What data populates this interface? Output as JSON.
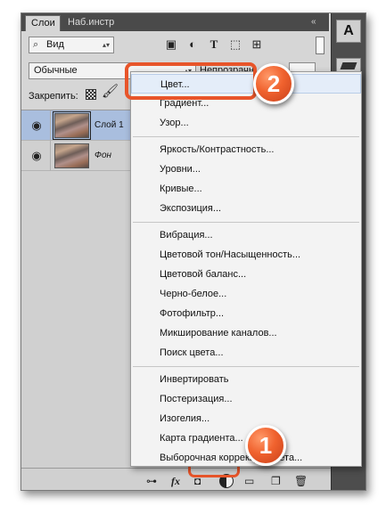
{
  "tabs": {
    "active": "Слои",
    "inactive": "Наб.инстр",
    "collapse": "«"
  },
  "filter": {
    "glyph": "⌕",
    "label": "Вид",
    "spinner": "▴▾"
  },
  "filter_icons": [
    "image-filter-icon",
    "adjustment-filter-icon",
    "type-filter-icon",
    "shape-filter-icon",
    "smart-object-filter-icon"
  ],
  "blend": {
    "label": "Обычные",
    "spinner": "▴▾"
  },
  "opacity": {
    "label": "Непрозрачн"
  },
  "lock": {
    "label": "Закрепить:"
  },
  "layers": [
    {
      "name": "Слой 1",
      "selected": true
    },
    {
      "name": "Фон",
      "selected": false,
      "italic": true
    }
  ],
  "tools": {
    "type_label": "A"
  },
  "menu": {
    "groups": [
      [
        "Цвет...",
        "Градиент...",
        "Узор..."
      ],
      [
        "Яркость/Контрастность...",
        "Уровни...",
        "Кривые...",
        "Экспозиция..."
      ],
      [
        "Вибрация...",
        "Цветовой тон/Насыщенность...",
        "Цветовой баланс...",
        "Черно-белое...",
        "Фотофильтр...",
        "Микширование каналов...",
        "Поиск цвета..."
      ],
      [
        "Инвертировать",
        "Постеризация...",
        "Изогелия...",
        "Карта градиента...",
        "Выборочная коррекция цвета..."
      ]
    ],
    "highlighted": "Цвет..."
  },
  "bottom_bar": [
    "link-icon",
    "fx-icon",
    "mask-icon",
    "adjustment-layer-icon",
    "folder-icon",
    "new-layer-icon",
    "trash-icon"
  ],
  "callouts": {
    "one": "1",
    "two": "2"
  },
  "colors": {
    "accent": "#e8552a",
    "selection": "#a9bede",
    "panel": "#d6d6d6"
  }
}
